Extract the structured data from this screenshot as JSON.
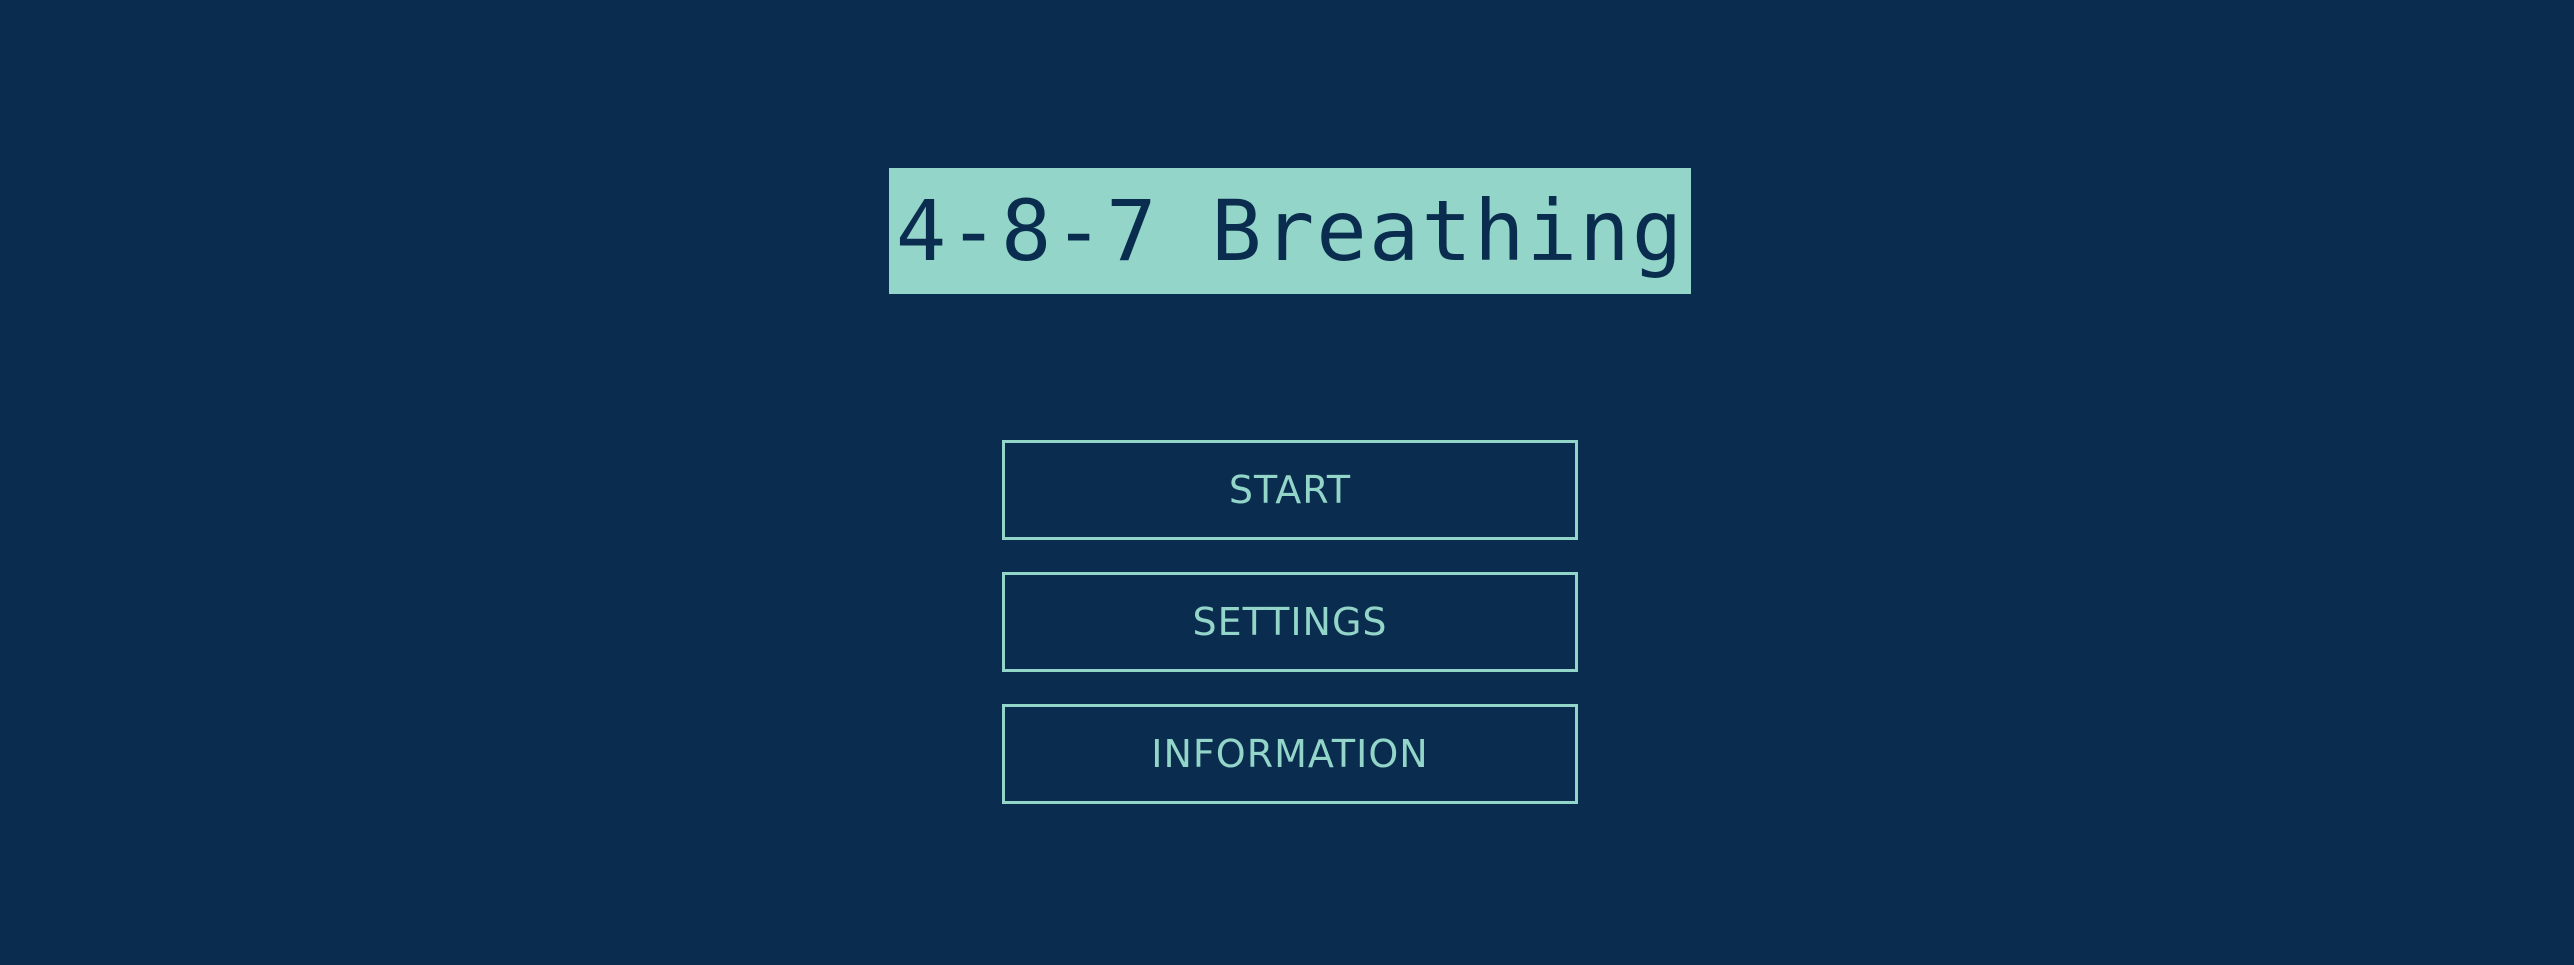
{
  "app": {
    "title": "4-8-7 Breathing"
  },
  "menu": {
    "start_label": "START",
    "settings_label": "SETTINGS",
    "information_label": "INFORMATION"
  },
  "colors": {
    "background": "#0a2d4f",
    "accent": "#93d5c8"
  }
}
